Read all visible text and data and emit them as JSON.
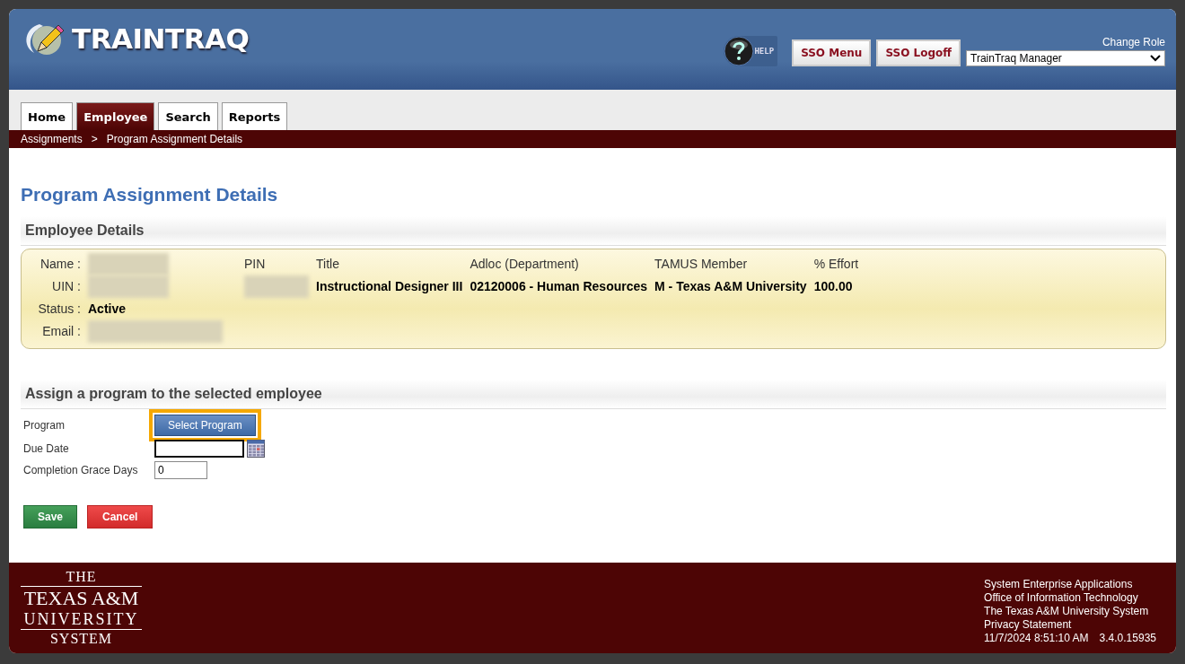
{
  "header": {
    "logo": "TRAINTRAQ",
    "help": "HELP",
    "buttons": [
      "SSO Menu",
      "SSO Logoff"
    ],
    "role_label": "Change Role",
    "role_value": "TrainTraq Manager"
  },
  "tabs": [
    {
      "label": "Home",
      "selected": false
    },
    {
      "label": "Employee",
      "selected": true
    },
    {
      "label": "Search",
      "selected": false
    },
    {
      "label": "Reports",
      "selected": false
    }
  ],
  "breadcrumb": [
    "Assignments",
    ">",
    "Program Assignment Details"
  ],
  "page_title": "Program Assignment Details",
  "employee_section": {
    "heading": "Employee Details",
    "fields": [
      {
        "label": "Name :",
        "redacted": true
      },
      {
        "label": "UIN :",
        "redacted": true
      },
      {
        "label": "Status :",
        "redacted": false,
        "value": "Active"
      },
      {
        "label": "Email :",
        "redacted": true
      }
    ],
    "columns": [
      {
        "header": "PIN",
        "redacted": true
      },
      {
        "header": "Title",
        "value": "Instructional Designer III"
      },
      {
        "header": "Adloc (Department)",
        "value": "02120006 - Human Resources"
      },
      {
        "header": "TAMUS Member",
        "value": "M - Texas A&M University"
      },
      {
        "header": "% Effort",
        "value": "100.00"
      }
    ]
  },
  "assign_section": {
    "heading": "Assign a program to the selected employee",
    "program": {
      "label": "Program",
      "button": "Select Program",
      "highlighted": true
    },
    "due_date": {
      "label": "Due Date"
    },
    "grace_days": {
      "label": "Completion Grace Days",
      "value": "0"
    }
  },
  "actions": [
    {
      "label": "Save",
      "kind": "save"
    },
    {
      "label": "Cancel",
      "kind": "cancel"
    }
  ],
  "footer": {
    "logo": [
      "THE",
      "TEXAS A&M",
      "UNIVERSITY",
      "SYSTEM"
    ],
    "lines": [
      "System Enterprise Applications",
      "Office of Information Technology",
      "The Texas A&M University System",
      "Privacy Statement"
    ],
    "timestamp": "11/7/2024 8:51:10 AM",
    "version": "3.4.0.15935"
  }
}
